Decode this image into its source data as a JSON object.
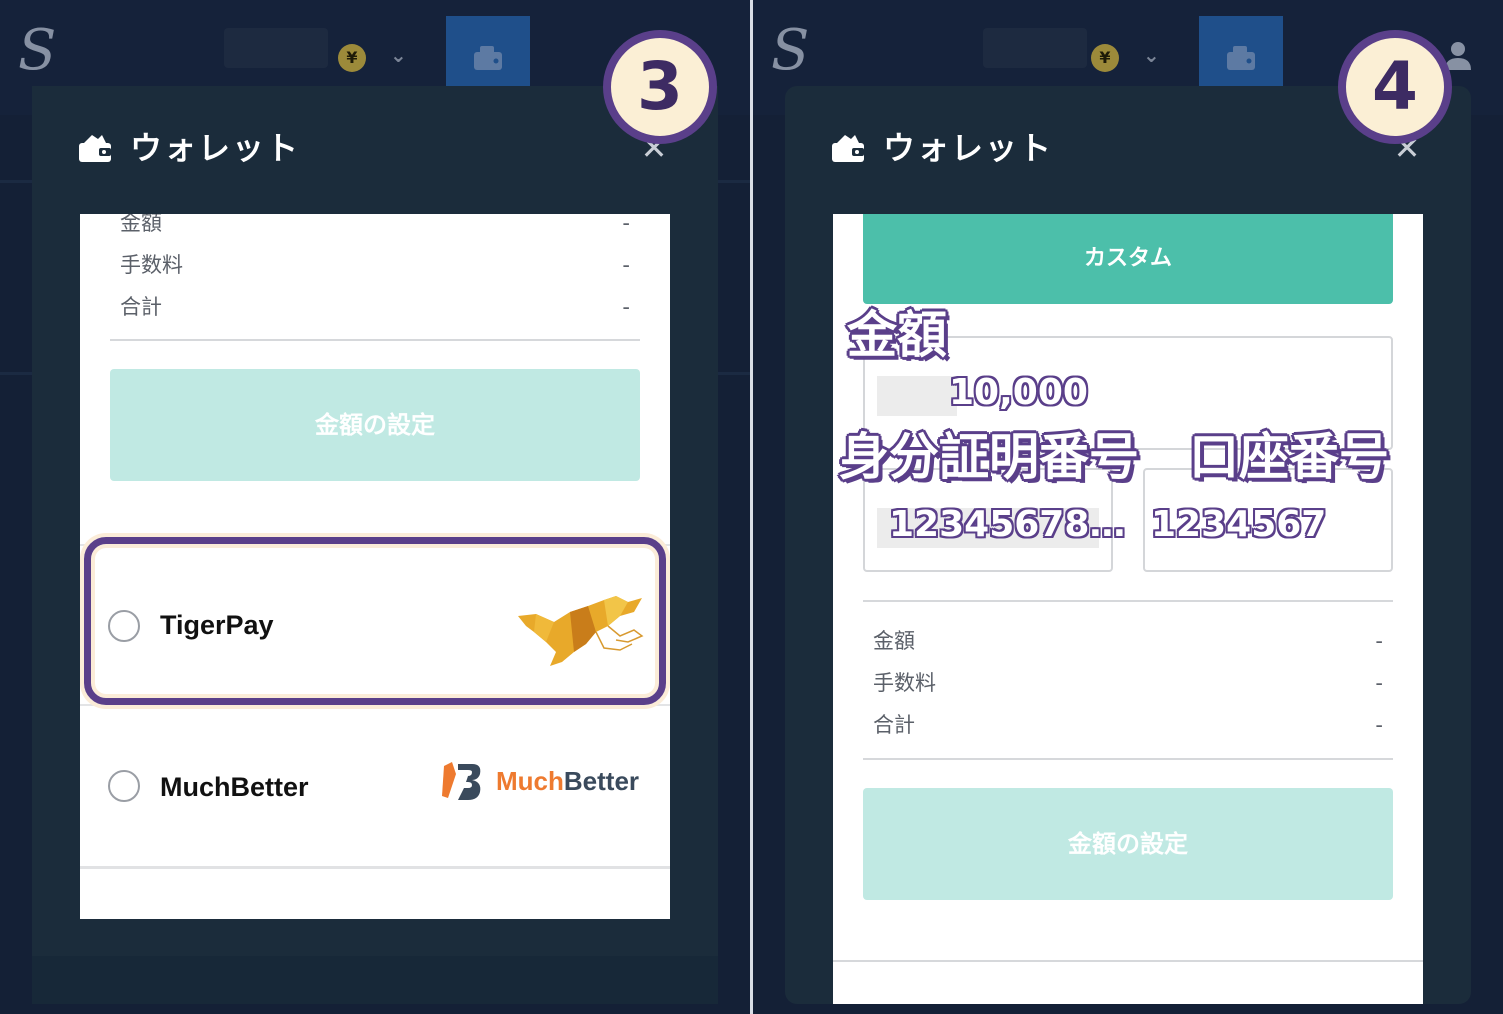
{
  "screens": {
    "left": {
      "step_number": "3",
      "modal": {
        "title": "ウォレット",
        "close_label": "✕"
      },
      "summary": [
        {
          "label": "金額",
          "value": "-"
        },
        {
          "label": "手数料",
          "value": "-"
        },
        {
          "label": "合計",
          "value": "-"
        }
      ],
      "set_amount_label": "金額の設定",
      "payment_methods": [
        {
          "name": "TigerPay",
          "highlighted": true
        },
        {
          "name": "MuchBetter",
          "highlighted": false,
          "logo_text_a": "Much",
          "logo_text_b": "Better"
        }
      ]
    },
    "right": {
      "step_number": "4",
      "modal": {
        "title": "ウォレット",
        "close_label": "✕"
      },
      "custom_label": "カスタム",
      "overlay": {
        "amount_label": "金額",
        "amount_value": "10,000",
        "id_label": "身分証明番号",
        "id_value": "12345678…",
        "account_label": "口座番号",
        "account_value": "1234567"
      },
      "summary": [
        {
          "label": "金額",
          "value": "-"
        },
        {
          "label": "手数料",
          "value": "-"
        },
        {
          "label": "合計",
          "value": "-"
        }
      ],
      "set_amount_label": "金額の設定"
    }
  },
  "colors": {
    "accent_purple": "#5a3f8a",
    "teal_active": "#4cbfaa",
    "teal_disabled": "#c0e9e3",
    "modal_bg": "#1b2c3b",
    "muchbetter_orange": "#ee7a2f"
  },
  "icons": {
    "wallet": "wallet-icon",
    "close": "close-icon",
    "yen": "yen-coin-icon",
    "chevron": "chevron-down-icon",
    "user": "user-icon",
    "tiger": "tiger-logo",
    "muchbetter": "muchbetter-logo"
  }
}
